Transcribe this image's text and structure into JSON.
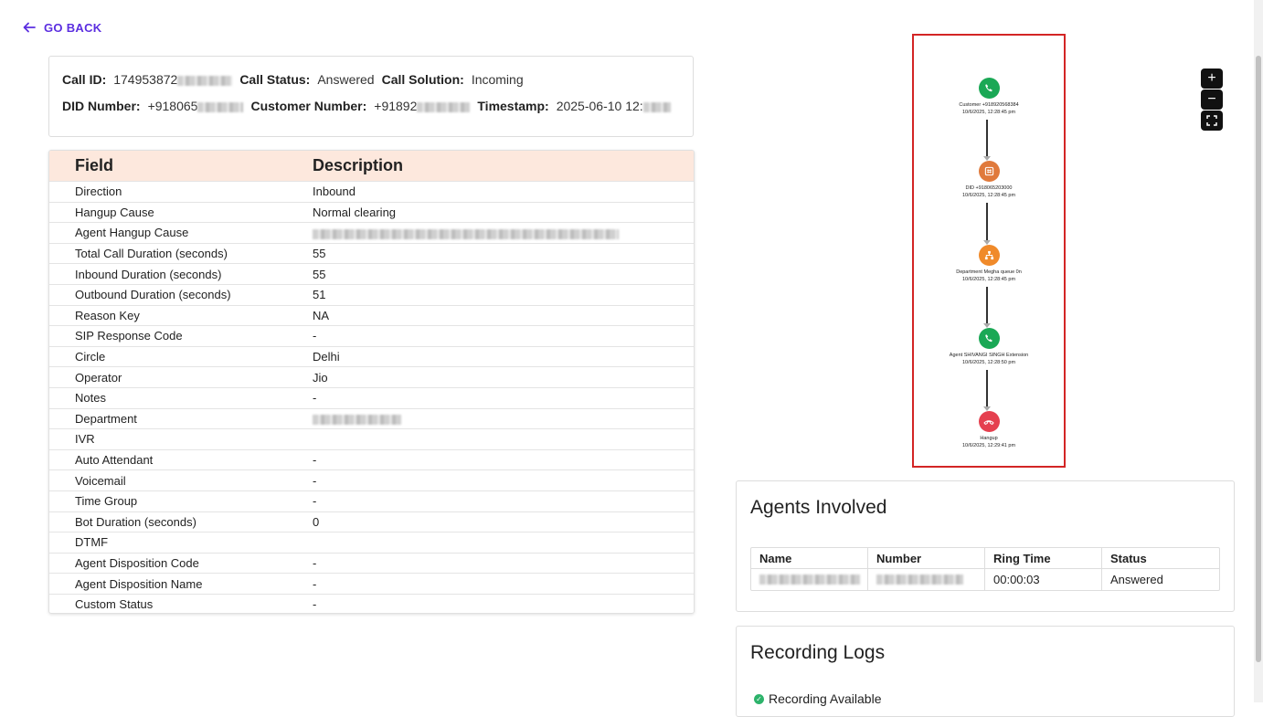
{
  "nav": {
    "go_back": "GO BACK"
  },
  "call_info": {
    "call_id_label": "Call ID:",
    "call_id_value": "174953872",
    "call_status_label": "Call Status:",
    "call_status_value": "Answered",
    "call_solution_label": "Call Solution:",
    "call_solution_value": "Incoming",
    "did_label": "DID Number:",
    "did_value": "+918065",
    "customer_label": "Customer Number:",
    "customer_value": "+91892",
    "timestamp_label": "Timestamp:",
    "timestamp_value": "2025-06-10 12:"
  },
  "details_table": {
    "col_field": "Field",
    "col_description": "Description",
    "rows": [
      {
        "field": "Direction",
        "desc": "Inbound"
      },
      {
        "field": "Hangup Cause",
        "desc": "Normal clearing"
      },
      {
        "field": "Agent Hangup Cause",
        "desc": ""
      },
      {
        "field": "Total Call Duration (seconds)",
        "desc": "55"
      },
      {
        "field": "Inbound Duration (seconds)",
        "desc": "55"
      },
      {
        "field": "Outbound Duration (seconds)",
        "desc": "51"
      },
      {
        "field": "Reason Key",
        "desc": "NA"
      },
      {
        "field": "SIP Response Code",
        "desc": "-"
      },
      {
        "field": "Circle",
        "desc": "Delhi"
      },
      {
        "field": "Operator",
        "desc": "Jio"
      },
      {
        "field": "Notes",
        "desc": "-"
      },
      {
        "field": "Department",
        "desc": ""
      },
      {
        "field": "IVR",
        "desc": ""
      },
      {
        "field": "Auto Attendant",
        "desc": "-"
      },
      {
        "field": "Voicemail",
        "desc": "-"
      },
      {
        "field": "Time Group",
        "desc": "-"
      },
      {
        "field": "Bot Duration (seconds)",
        "desc": "0"
      },
      {
        "field": "DTMF",
        "desc": ""
      },
      {
        "field": "Agent Disposition Code",
        "desc": "-"
      },
      {
        "field": "Agent Disposition Name",
        "desc": "-"
      },
      {
        "field": "Custom Status",
        "desc": "-"
      }
    ]
  },
  "flow": {
    "nodes": [
      {
        "label": "Customer +918920568384",
        "time": "10/6/2025, 12:28:45 pm",
        "color": "#1aa855",
        "icon": "phone-icon"
      },
      {
        "label": "DID +918065203000",
        "time": "10/6/2025, 12:28:45 pm",
        "color": "#e07a3c",
        "icon": "hash-icon"
      },
      {
        "label": "Department Megha queue 0n",
        "time": "10/6/2025, 12:28:45 pm",
        "color": "#f08a2a",
        "icon": "sitemap-icon"
      },
      {
        "label": "Agent SHIVANGI SINGH Extension",
        "time": "10/6/2025, 12:28:50 pm",
        "color": "#1aa855",
        "icon": "phone-icon"
      },
      {
        "label": "Hangup",
        "time": "10/6/2025, 12:29:41 pm",
        "color": "#e5404f",
        "icon": "hangup-icon"
      }
    ],
    "zoom_in": "+",
    "zoom_out": "−",
    "fit": "⛶"
  },
  "agents": {
    "title": "Agents Involved",
    "headers": [
      "Name",
      "Number",
      "Ring Time",
      "Status"
    ],
    "rows": [
      {
        "ring_time": "00:00:03",
        "status": "Answered"
      }
    ]
  },
  "recordings": {
    "title": "Recording Logs",
    "status": "Recording Available"
  }
}
